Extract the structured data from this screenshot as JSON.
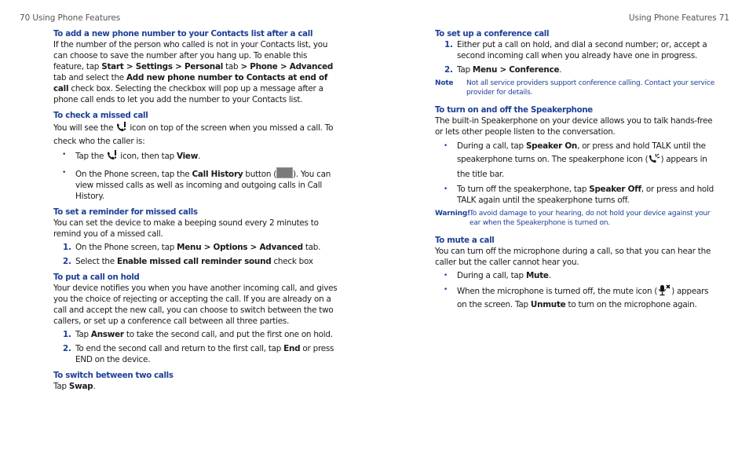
{
  "left_page": {
    "header": "70  Using Phone Features",
    "sections": {
      "add_number": {
        "heading": "To add a new phone number to your Contacts list after a call",
        "p1": "If the number of the person who called is not in your Contacts list, you can choose to save the number after you hang up. To enable this feature, tap ",
        "b1": "Start > Settings > Personal",
        "p2": " tab ",
        "b2": "> Phone > Advanced",
        "p3": " tab and select the ",
        "b3": "Add new phone number to Contacts at end of call",
        "p4": " check box. Selecting the checkbox will pop up a message after a phone call ends to let you add the number to your Contacts list."
      },
      "missed_call": {
        "heading": "To check a missed call",
        "p1": "You will see the ",
        "p2": " icon on top of the screen when you missed a call. To check who the caller is:",
        "bullet1_a": "Tap the ",
        "bullet1_b": " icon, then tap ",
        "bullet1_bold": "View",
        "bullet1_end": ".",
        "bullet2_a": "On the Phone screen, tap the ",
        "bullet2_bold": "Call History",
        "bullet2_b": " button (",
        "bullet2_c": "). You can view missed calls as well as incoming and outgoing calls in Call History."
      },
      "reminder": {
        "heading": "To set a reminder for missed calls",
        "p1": "You can set the device to make a beeping sound every 2 minutes to remind you of a missed call.",
        "step1_num": "1.",
        "step1_a": "On the Phone screen, tap ",
        "step1_bold": "Menu > Options > Advanced",
        "step1_b": " tab.",
        "step2_num": "2.",
        "step2_a": "Select the ",
        "step2_bold": "Enable missed call reminder sound",
        "step2_b": " check box"
      },
      "hold": {
        "heading": "To put a call on hold",
        "p1": "Your device notifies you when you have another incoming call, and gives you the choice of rejecting or accepting the call. If you are already on a call and accept the new call, you can choose to switch between the two callers, or set up a conference call between all three parties.",
        "step1_num": "1.",
        "step1_a": "Tap ",
        "step1_bold": "Answer",
        "step1_b": " to take the second call, and put the first one on hold.",
        "step2_num": "2.",
        "step2_a": "To end the second call and return to the first call, tap ",
        "step2_bold": "End",
        "step2_b": " or press END on the device."
      },
      "switch": {
        "heading": "To switch between two calls",
        "p1": "Tap ",
        "bold": "Swap",
        "p2": "."
      }
    }
  },
  "right_page": {
    "header": "Using Phone Features  71",
    "sections": {
      "conference": {
        "heading": "To set up a conference call",
        "step1_num": "1.",
        "step1": "Either put a call on hold, and dial a second number; or, accept a second incoming call when you already have one in progress.",
        "step2_num": "2.",
        "step2_a": "Tap ",
        "step2_bold": "Menu > Conference",
        "step2_b": ".",
        "note_label": "Note",
        "note_text": "Not all service providers support conference calling. Contact your service provider for details."
      },
      "speakerphone": {
        "heading": "To turn on and off the Speakerphone",
        "p1": "The built-in Speakerphone on your device allows you to talk hands-free or lets other people listen to the conversation.",
        "bullet1_a": "During a call, tap ",
        "bullet1_bold": "Speaker On",
        "bullet1_b": ", or press and hold TALK until the speakerphone turns on. The speakerphone icon (",
        "bullet1_c": ") appears in the title bar.",
        "bullet2_a": "To turn off the speakerphone, tap ",
        "bullet2_bold": "Speaker Off",
        "bullet2_b": ", or press and hold TALK again until the speakerphone turns off.",
        "warning_label": "Warning!",
        "warning_text": "To avoid damage to your hearing, do not hold your device against your ear when the Speakerphone is turned on."
      },
      "mute": {
        "heading": "To mute a call",
        "p1": "You can turn off the microphone during a call, so that you can hear the caller but the caller cannot hear you.",
        "bullet1_a": "During a call, tap ",
        "bullet1_bold": "Mute",
        "bullet1_b": ".",
        "bullet2_a": "When the microphone is turned off, the mute icon (",
        "bullet2_b": ") appears on the screen. Tap ",
        "bullet2_bold": "Unmute",
        "bullet2_c": " to turn on the microphone again."
      }
    }
  },
  "bullet_glyph": "•",
  "colors": {
    "heading": "#1d3f95",
    "body": "#1a1a1a",
    "header": "#555555"
  }
}
